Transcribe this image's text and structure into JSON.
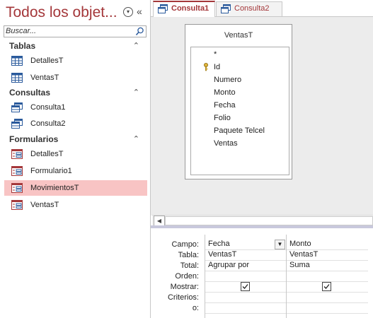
{
  "nav": {
    "title": "Todos los objet...",
    "search_placeholder": "Buscar...",
    "groups": [
      {
        "label": "Tablas",
        "items": [
          "DetallesT",
          "VentasT"
        ]
      },
      {
        "label": "Consultas",
        "items": [
          "Consulta1",
          "Consulta2"
        ]
      },
      {
        "label": "Formularios",
        "items": [
          "DetallesT",
          "Formulario1",
          "MovimientosT",
          "VentasT"
        ]
      }
    ]
  },
  "tabs": [
    {
      "label": "Consulta1",
      "active": true
    },
    {
      "label": "Consulta2",
      "active": false
    }
  ],
  "design": {
    "table_title": "VentasT",
    "fields": [
      "*",
      "Id",
      "Numero",
      "Monto",
      "Fecha",
      "Folio",
      "Paquete Telcel",
      "Ventas"
    ]
  },
  "grid": {
    "row_labels": [
      "Campo:",
      "Tabla:",
      "Total:",
      "Orden:",
      "Mostrar:",
      "Criterios:",
      "o:"
    ],
    "columns": [
      {
        "campo": "Fecha",
        "tabla": "VentasT",
        "total": "Agrupar por",
        "orden": "",
        "mostrar": true
      },
      {
        "campo": "Monto",
        "tabla": "VentasT",
        "total": "Suma",
        "orden": "",
        "mostrar": true
      }
    ]
  },
  "colors": {
    "accent": "#a4373a",
    "selected": "#f8c4c4"
  }
}
